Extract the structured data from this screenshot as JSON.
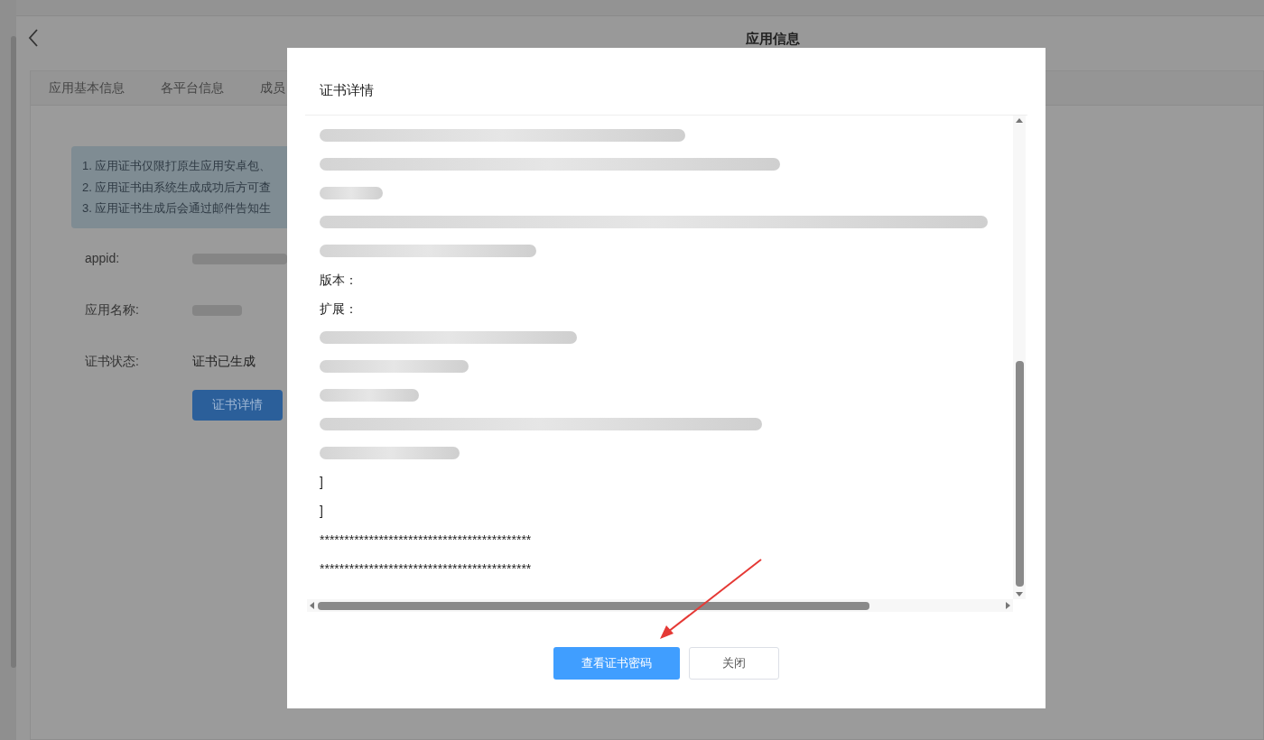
{
  "page": {
    "title": "应用信息",
    "tabs": [
      "应用基本信息",
      "各平台信息",
      "成员"
    ],
    "notices": [
      "1. 应用证书仅限打原生应用安卓包、",
      "2. 应用证书由系统生成成功后方可查",
      "3. 应用证书生成后会通过邮件告知生"
    ],
    "fields": [
      {
        "label": "appid:",
        "kind": "redacted"
      },
      {
        "label": "应用名称:",
        "kind": "redacted"
      },
      {
        "label": "证书状态:",
        "kind": "text",
        "value": "证书已生成"
      }
    ],
    "detail_button": "证书详情"
  },
  "dialog": {
    "title": "证书详情",
    "lines": [
      {
        "kind": "redacted"
      },
      {
        "kind": "redacted"
      },
      {
        "kind": "redacted"
      },
      {
        "kind": "redacted"
      },
      {
        "kind": "redacted"
      },
      {
        "kind": "text",
        "text": "版本："
      },
      {
        "kind": "text",
        "text": "扩展："
      },
      {
        "kind": "redacted"
      },
      {
        "kind": "redacted"
      },
      {
        "kind": "redacted"
      },
      {
        "kind": "redacted"
      },
      {
        "kind": "redacted"
      },
      {
        "kind": "text",
        "text": "]"
      },
      {
        "kind": "text",
        "text": "]"
      },
      {
        "kind": "text",
        "text": "*******************************************"
      },
      {
        "kind": "text",
        "text": "*******************************************"
      }
    ],
    "buttons": [
      {
        "label": "查看证书密码",
        "kind": "primary"
      },
      {
        "label": "关闭",
        "kind": "default"
      }
    ]
  }
}
